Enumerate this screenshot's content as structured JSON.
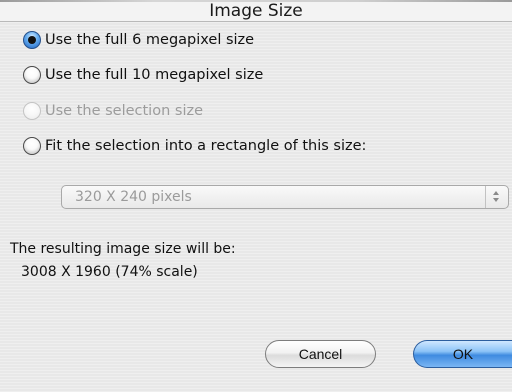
{
  "dialog": {
    "title": "Image Size"
  },
  "options": [
    {
      "label": "Use the full 6 megapixel size",
      "selected": true,
      "enabled": true
    },
    {
      "label": "Use the full 10 megapixel size",
      "selected": false,
      "enabled": true
    },
    {
      "label": "Use the selection size",
      "selected": false,
      "enabled": false
    },
    {
      "label": "Fit the selection into a rectangle of this size:",
      "selected": false,
      "enabled": true
    }
  ],
  "size_popup": {
    "value": "320 X 240 pixels",
    "enabled": false
  },
  "result": {
    "label": "The resulting image size will be:",
    "value": "3008 X 1960 (74% scale)"
  },
  "buttons": {
    "cancel": "Cancel",
    "ok": "OK"
  },
  "colors": {
    "accent": "#3f8be0",
    "disabled_text": "#9c9c9c"
  }
}
